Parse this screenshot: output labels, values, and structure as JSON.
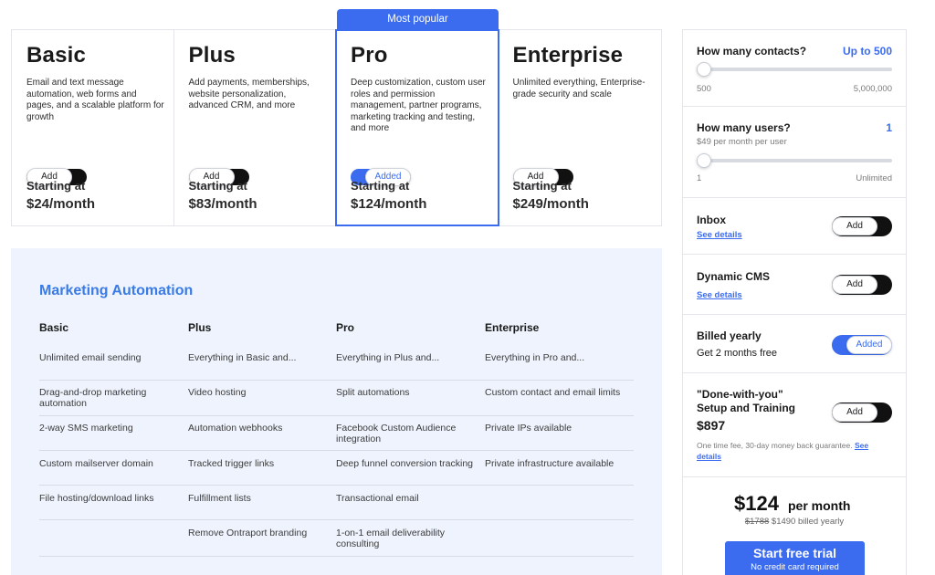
{
  "badge": "Most popular",
  "plans": [
    {
      "name": "Basic",
      "desc": "Email and text message automation, web forms and pages, and a scalable platform for growth",
      "toggle": "Add",
      "lead": "Starting at",
      "price": "$24/month"
    },
    {
      "name": "Plus",
      "desc": "Add payments, memberships, website personalization, advanced CRM, and more",
      "toggle": "Add",
      "lead": "Starting at",
      "price": "$83/month"
    },
    {
      "name": "Pro",
      "desc": "Deep customization, custom user roles and permission management, partner programs, marketing tracking and testing, and more",
      "toggle": "Added",
      "lead": "Starting at",
      "price": "$124/month"
    },
    {
      "name": "Enterprise",
      "desc": "Unlimited everything, Enterprise-grade security and scale",
      "toggle": "Add",
      "lead": "Starting at",
      "price": "$249/month"
    }
  ],
  "features": {
    "title": "Marketing Automation",
    "headers": [
      "Basic",
      "Plus",
      "Pro",
      "Enterprise"
    ],
    "rows": [
      [
        "Unlimited email sending",
        "Everything in Basic and...",
        "Everything in Plus and...",
        "Everything in Pro and..."
      ],
      [
        "Drag-and-drop marketing automation",
        "Video hosting",
        "Split automations",
        "Custom contact and email limits"
      ],
      [
        "2-way SMS marketing",
        "Automation webhooks",
        "Facebook Custom Audience integration",
        "Private IPs available"
      ],
      [
        "Custom mailserver domain",
        "Tracked trigger links",
        "Deep funnel conversion tracking",
        "Private infrastructure available"
      ],
      [
        "File hosting/download links",
        "Fulfillment lists",
        "Transactional email",
        ""
      ],
      [
        "",
        "Remove Ontraport branding",
        "1-on-1 email deliverability consulting",
        ""
      ]
    ]
  },
  "sidebar": {
    "contacts": {
      "label": "How many contacts?",
      "value": "Up to 500",
      "min": "500",
      "max": "5,000,000",
      "level": 0
    },
    "users": {
      "label": "How many users?",
      "value": "1",
      "sub": "$49 per month per user",
      "min": "1",
      "max": "Unlimited",
      "level": 0
    },
    "inbox": {
      "label": "Inbox",
      "link": "See details",
      "toggle": "Add"
    },
    "cms": {
      "label": "Dynamic CMS",
      "link": "See details",
      "toggle": "Add"
    },
    "billing": {
      "label": "Billed yearly",
      "sub": "Get 2 months free",
      "toggle": "Added"
    },
    "setup": {
      "label_line1": "\"Done-with-you\"",
      "label_line2": "Setup and Training",
      "price": "$897",
      "note": "One time fee, 30-day money back guarantee.",
      "link": "See details",
      "toggle": "Add"
    },
    "total": {
      "price": "$124",
      "per": "per month",
      "old": "$1788",
      "new": "$1490 billed yearly"
    },
    "cta": {
      "main": "Start free trial",
      "sub": "No credit card required"
    }
  },
  "colors": {
    "accent": "#3b6cf0",
    "feature_bg": "#eef3fd",
    "feature_title": "#3a7be6"
  }
}
